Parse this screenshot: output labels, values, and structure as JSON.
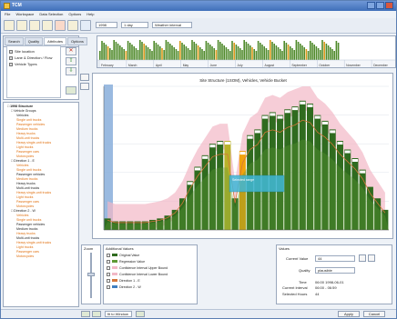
{
  "window": {
    "title": "TCM"
  },
  "menu": [
    "File",
    "Workspace",
    "Data Selection",
    "Options",
    "Help"
  ],
  "toolbar": {
    "year_value": "1998",
    "interval_value": "1 day",
    "mode_value": "Weather interval"
  },
  "timeline": {
    "months": [
      "February",
      "March",
      "April",
      "May",
      "June",
      "July",
      "August",
      "September",
      "October",
      "November",
      "December"
    ]
  },
  "left_panel": {
    "tabs": [
      "Search",
      "Quality",
      "Attributes",
      "Options"
    ],
    "items": [
      "Site location",
      "Lane & Direction / Flow",
      "Vehicle Types"
    ],
    "up_button": "⇧",
    "down_button": "⇩"
  },
  "tree": {
    "rows": [
      {
        "text": "□ 1998 Structure",
        "level": 0,
        "orange": false
      },
      {
        "text": "□ Vehicle Groups",
        "level": 1,
        "orange": false
      },
      {
        "text": "Vehicles",
        "level": 2,
        "orange": false
      },
      {
        "text": "Single unit trucks",
        "level": 2,
        "orange": true
      },
      {
        "text": "Passenger vehicles",
        "level": 2,
        "orange": true
      },
      {
        "text": "Medium trucks",
        "level": 2,
        "orange": true
      },
      {
        "text": "Heavy trucks",
        "level": 2,
        "orange": true
      },
      {
        "text": "Multi-unit trucks",
        "level": 2,
        "orange": true
      },
      {
        "text": "Heavy single-unit trucks",
        "level": 2,
        "orange": true
      },
      {
        "text": "Light trucks",
        "level": 2,
        "orange": true
      },
      {
        "text": "Passenger cars",
        "level": 2,
        "orange": true
      },
      {
        "text": "Motorcycles",
        "level": 2,
        "orange": true
      },
      {
        "text": "□ Direction 1 - E",
        "level": 1,
        "orange": false
      },
      {
        "text": "Vehicles",
        "level": 2,
        "orange": true
      },
      {
        "text": "Single unit trucks",
        "level": 2,
        "orange": true
      },
      {
        "text": "Passenger vehicles",
        "level": 2,
        "orange": false
      },
      {
        "text": "Medium trucks",
        "level": 2,
        "orange": true
      },
      {
        "text": "Heavy trucks",
        "level": 2,
        "orange": false
      },
      {
        "text": "Multi-unit trucks",
        "level": 2,
        "orange": false
      },
      {
        "text": "Heavy single-unit trucks",
        "level": 2,
        "orange": true
      },
      {
        "text": "Light trucks",
        "level": 2,
        "orange": true
      },
      {
        "text": "Passenger cars",
        "level": 2,
        "orange": true
      },
      {
        "text": "Motorcycles",
        "level": 2,
        "orange": true
      },
      {
        "text": "□ Direction 2 - W",
        "level": 1,
        "orange": false
      },
      {
        "text": "Vehicles",
        "level": 2,
        "orange": true
      },
      {
        "text": "Single unit trucks",
        "level": 2,
        "orange": true
      },
      {
        "text": "Passenger vehicles",
        "level": 2,
        "orange": false
      },
      {
        "text": "Medium trucks",
        "level": 2,
        "orange": false
      },
      {
        "text": "Heavy trucks",
        "level": 2,
        "orange": true
      },
      {
        "text": "Multi-unit trucks",
        "level": 2,
        "orange": false
      },
      {
        "text": "Heavy single-unit trucks",
        "level": 2,
        "orange": true
      },
      {
        "text": "Light trucks",
        "level": 2,
        "orange": true
      },
      {
        "text": "Passenger cars",
        "level": 2,
        "orange": true
      },
      {
        "text": "Motorcycles",
        "level": 2,
        "orange": true
      }
    ]
  },
  "chart": {
    "title": "Site Structure (1SOM), Vehicles, Vehicle Bucket",
    "tooltip_text": "Selected range",
    "colors": {
      "bar": "#2f6b1f",
      "bar_light": "#5e9a35",
      "band": "#f2b8c6",
      "line": "#d4763a",
      "highlight": "#f2a20d",
      "highlight2": "#b9b22a",
      "selection": "#8fb2dd",
      "tooltip": "#3fb7d8"
    }
  },
  "chart_data": {
    "type": "bar",
    "title": "Site Structure (1SOM), Vehicles, Vehicle Bucket",
    "series": [
      {
        "name": "Original Value",
        "values": [
          8,
          6,
          6,
          6,
          6,
          6,
          7,
          8,
          10,
          14,
          22,
          34,
          44,
          52,
          60,
          62,
          62,
          22,
          55,
          66,
          70,
          80,
          82,
          80,
          84,
          86,
          90,
          88,
          80,
          76,
          70,
          62,
          56,
          50,
          42,
          30,
          22,
          14
        ]
      }
    ],
    "ylim": [
      0,
      100
    ]
  },
  "bottom": {
    "zoom_label": "Zoom",
    "legend_title": "Additional Values",
    "legend": [
      "Original Value",
      "Regression Value",
      "Confidence Interval Upper Bound",
      "Confidence Interval Lower Bound",
      "Direction 1 - E",
      "Direction 2 - W"
    ],
    "values_title": "Values",
    "current_value_label": "Current Value",
    "quality_label": "Quality",
    "time_label": "Time",
    "current_interval_label": "Current Interval",
    "selected hours_label": "Selected Hours",
    "current_value": "44",
    "quality_value": "plausible",
    "time_value": "06:00 1998-06-01",
    "current_interval_value": "06:00 - 06:59",
    "selected_hours_value": "44",
    "zoom_options_value": "fit to Window",
    "apply_label": "Apply",
    "cancel_label": "Cancel"
  }
}
